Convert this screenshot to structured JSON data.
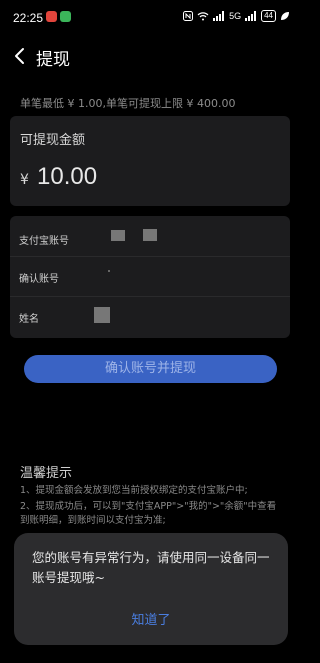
{
  "status_bar": {
    "time": "22:25",
    "network": "5G",
    "battery": "44"
  },
  "nav": {
    "title": "提现"
  },
  "limit_text": "单笔最低 ¥ 1.00,单笔可提现上限 ¥ 400.00",
  "amount": {
    "label": "可提现金额",
    "currency": "¥",
    "value": "10.00"
  },
  "fields": {
    "alipay_label": "支付宝账号",
    "confirm_label": "确认账号",
    "name_label": "姓名"
  },
  "confirm_button": "确认账号并提现",
  "tips": {
    "title": "温馨提示",
    "items": [
      "1、提现金额会发放到您当前授权绑定的支付宝账户中;",
      "2、提现成功后，可以到\"支付宝APP\">\"我的\">\"余额\"中查看到账明细，到账时间以支付宝为准;"
    ]
  },
  "dialog": {
    "message": "您的账号有异常行为，请使用同一设备同一账号提现哦~",
    "button": "知道了"
  },
  "colors": {
    "accent": "#3a63c4",
    "dialog_link": "#4a7ee0"
  }
}
